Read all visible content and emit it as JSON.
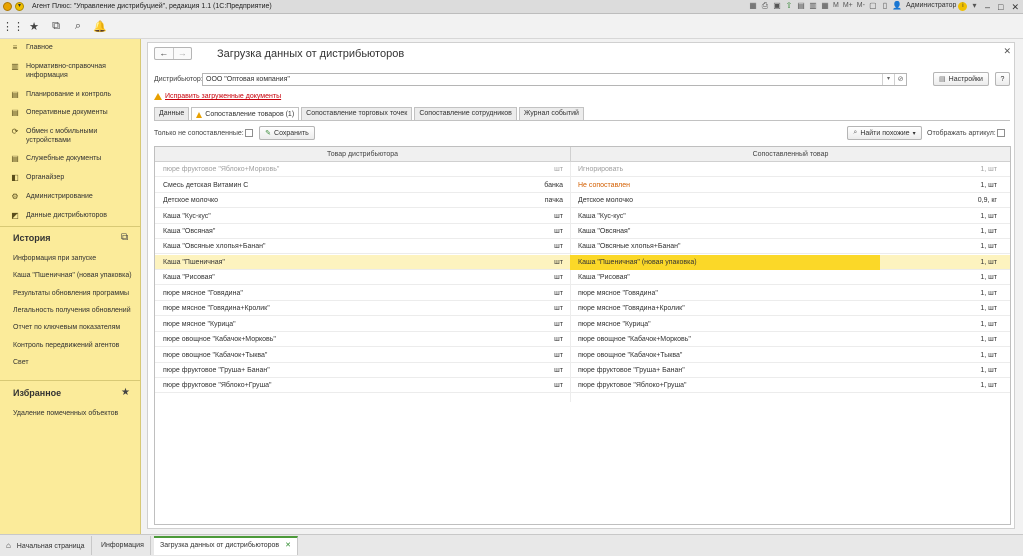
{
  "app": {
    "title": "Агент Плюс: \"Управление дистрибуцией\", редакция 1.1  (1С:Предприятие)",
    "user": "Администратор",
    "toolbar_m": [
      "M",
      "M+",
      "M-"
    ]
  },
  "sidebar": {
    "items": [
      {
        "label": "Главное",
        "icon": "menu-icon"
      },
      {
        "label": "Нормативно-справочная информация",
        "icon": "bars-icon"
      },
      {
        "label": "Планирование и контроль",
        "icon": "chart-icon"
      },
      {
        "label": "Оперативные документы",
        "icon": "document-icon"
      },
      {
        "label": "Обмен с мобильными устройствами",
        "icon": "sync-icon"
      },
      {
        "label": "Служебные документы",
        "icon": "document-icon"
      },
      {
        "label": "Органайзер",
        "icon": "organizer-icon"
      },
      {
        "label": "Администрирование",
        "icon": "gear-icon"
      },
      {
        "label": "Данные дистрибьюторов",
        "icon": "data-icon"
      }
    ],
    "history_title": "История",
    "history": [
      "Информация при запуске",
      "Каша \"Пшеничная\" (новая упаковка)",
      "Результаты обновления программы",
      "Легальность получения обновлений",
      "Отчет по ключевым показателям",
      "Контроль передвижений агентов",
      "Свет"
    ],
    "favorites_title": "Избранное",
    "favorites": [
      "Удаление помеченных объектов"
    ]
  },
  "page": {
    "title": "Загрузка данных от дистрибьюторов",
    "distributor_label": "Дистрибьютор:",
    "distributor_value": "ООО \"Оптовая компания\"",
    "settings_label": "Настройки",
    "help_label": "?",
    "warning_link": "Исправить загруженные документы",
    "tabs": [
      "Данные",
      "Сопоставление товаров (1)",
      "Сопоставление торговых точек",
      "Сопоставление сотрудников",
      "Журнал событий"
    ],
    "only_unmatched_label": "Только не сопоставленные:",
    "save_label": "Сохранить",
    "find_similar_label": "Найти похожие",
    "show_article_label": "Отображать артикул:"
  },
  "table": {
    "headers": [
      "Товар дистрибьютора",
      "Сопоставленный товар"
    ],
    "rows": [
      {
        "product": "пюре фруктовое \"Яблоко+Морковь\"",
        "unit": "шт",
        "match": "Игнорировать",
        "qty": "1, шт"
      },
      {
        "product": "Смесь детская Витамин С",
        "unit": "банка",
        "match": "Не сопоставлен",
        "qty": "1, шт"
      },
      {
        "product": "Детское молочко",
        "unit": "пачка",
        "match": "Детское молочко",
        "qty": "0,9, кг"
      },
      {
        "product": "Каша \"Кус-кус\"",
        "unit": "шт",
        "match": "Каша \"Кус-кус\"",
        "qty": "1, шт"
      },
      {
        "product": "Каша \"Овсяная\"",
        "unit": "шт",
        "match": "Каша \"Овсяная\"",
        "qty": "1, шт"
      },
      {
        "product": "Каша \"Овсяные хлопья+Банан\"",
        "unit": "шт",
        "match": "Каша \"Овсяные хлопья+Банан\"",
        "qty": "1, шт"
      },
      {
        "product": "Каша \"Пшеничная\"",
        "unit": "шт",
        "match": "Каша \"Пшеничная\" (новая упаковка)",
        "qty": "1, шт"
      },
      {
        "product": "Каша \"Рисовая\"",
        "unit": "шт",
        "match": "Каша \"Рисовая\"",
        "qty": "1, шт"
      },
      {
        "product": "пюре мясное \"Говядина\"",
        "unit": "шт",
        "match": "пюре мясное \"Говядина\"",
        "qty": "1, шт"
      },
      {
        "product": "пюре мясное \"Говядина+Кролик\"",
        "unit": "шт",
        "match": "пюре мясное \"Говядина+Кролик\"",
        "qty": "1, шт"
      },
      {
        "product": "пюре мясное \"Курица\"",
        "unit": "шт",
        "match": "пюре мясное \"Курица\"",
        "qty": "1, шт"
      },
      {
        "product": "пюре овощное \"Кабачок+Морковь\"",
        "unit": "шт",
        "match": "пюре овощное \"Кабачок+Морковь\"",
        "qty": "1, шт"
      },
      {
        "product": "пюре овощное \"Кабачок+Тыква\"",
        "unit": "шт",
        "match": "пюре овощное \"Кабачок+Тыква\"",
        "qty": "1, шт"
      },
      {
        "product": "пюре фруктовое \"Груша+ Банан\"",
        "unit": "шт",
        "match": "пюре фруктовое \"Груша+ Банан\"",
        "qty": "1, шт"
      },
      {
        "product": "пюре фруктовое \"Яблоко+Груша\"",
        "unit": "шт",
        "match": "пюре фруктовое \"Яблоко+Груша\"",
        "qty": "1, шт"
      }
    ]
  },
  "bottom_tabs": [
    "Начальная страница",
    "Информация",
    "Загрузка данных от дистрибьюторов"
  ],
  "colors": {
    "sidebar_bg": "#fbeb9a",
    "selected_row": "#fdf3bf",
    "selected_match": "#fbd828",
    "warning_red": "#c8000a",
    "unmatched_orange": "#d35f00",
    "active_tab_accent": "#4c9a3a"
  }
}
